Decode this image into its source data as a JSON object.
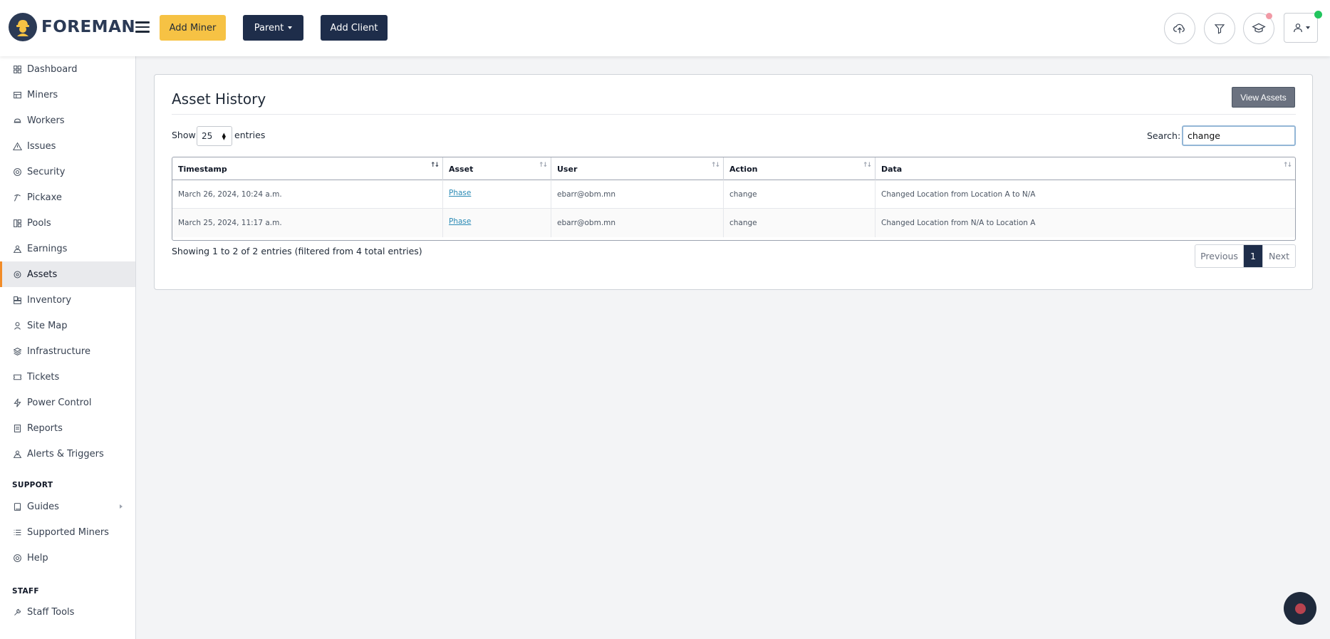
{
  "brand": {
    "name": "FOREMAN"
  },
  "header": {
    "add_miner": "Add Miner",
    "parent": "Parent",
    "add_client": "Add Client",
    "icons": [
      "cloud-upload-icon",
      "filter-icon",
      "graduation-cap-icon",
      "user-icon"
    ]
  },
  "sidebar": {
    "items": [
      {
        "label": "Dashboard",
        "icon": "dashboard-icon"
      },
      {
        "label": "Miners",
        "icon": "miners-icon"
      },
      {
        "label": "Workers",
        "icon": "workers-icon"
      },
      {
        "label": "Issues",
        "icon": "warning-icon"
      },
      {
        "label": "Security",
        "icon": "shield-icon"
      },
      {
        "label": "Pickaxe",
        "icon": "pickaxe-icon"
      },
      {
        "label": "Pools",
        "icon": "pools-icon"
      },
      {
        "label": "Earnings",
        "icon": "earnings-icon"
      },
      {
        "label": "Assets",
        "icon": "gear-icon",
        "active": true
      },
      {
        "label": "Inventory",
        "icon": "inventory-icon"
      },
      {
        "label": "Site Map",
        "icon": "site-map-icon"
      },
      {
        "label": "Infrastructure",
        "icon": "layers-icon"
      },
      {
        "label": "Tickets",
        "icon": "ticket-icon"
      },
      {
        "label": "Power Control",
        "icon": "bolt-icon"
      },
      {
        "label": "Reports",
        "icon": "report-icon"
      },
      {
        "label": "Alerts & Triggers",
        "icon": "bell-icon"
      }
    ],
    "support_title": "SUPPORT",
    "support_items": [
      {
        "label": "Guides",
        "icon": "book-icon"
      },
      {
        "label": "Supported Miners",
        "icon": "list-icon"
      },
      {
        "label": "Help",
        "icon": "help-icon"
      }
    ],
    "staff_title": "STAFF",
    "staff_items": [
      {
        "label": "Staff Tools",
        "icon": "tools-icon"
      }
    ]
  },
  "main": {
    "title": "Asset History",
    "view_assets": "View Assets",
    "show_label": "Show",
    "entries_value": "25",
    "entries_label": "entries",
    "search_label": "Search:",
    "search_value": "change",
    "columns": [
      "Timestamp",
      "Asset",
      "User",
      "Action",
      "Data"
    ],
    "rows": [
      {
        "timestamp": "March 26, 2024, 10:24 a.m.",
        "asset": "Phase",
        "user": "ebarr@obm.mn",
        "action": "change",
        "data": "Changed Location from Location A to N/A"
      },
      {
        "timestamp": "March 25, 2024, 11:17 a.m.",
        "asset": "Phase",
        "user": "ebarr@obm.mn",
        "action": "change",
        "data": "Changed Location from N/A to Location A"
      }
    ],
    "info": "Showing 1 to 2 of 2 entries (filtered from 4 total entries)",
    "pager": {
      "previous": "Previous",
      "current": "1",
      "next": "Next"
    }
  },
  "colors": {
    "accent": "#f28c28",
    "navy": "#1e2d4a",
    "yellow": "#f6c244"
  }
}
